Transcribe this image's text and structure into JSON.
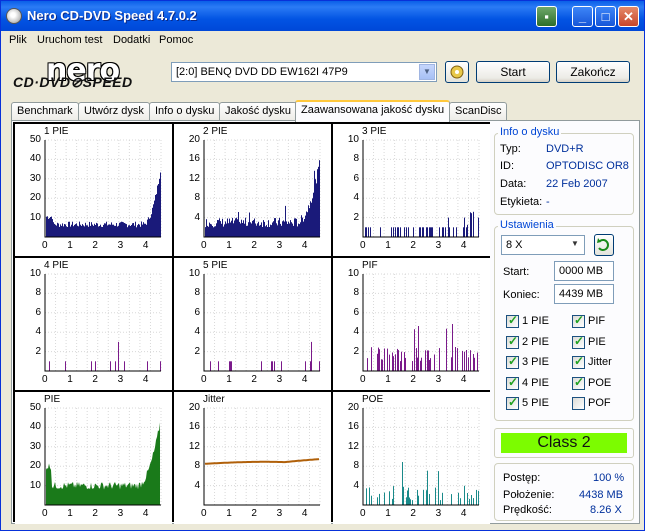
{
  "window": {
    "title": "Nero CD-DVD Speed 4.7.0.2",
    "minimize": "_",
    "maximize": "□",
    "close": "✕"
  },
  "menu": [
    "Plik",
    "Uruchom test",
    "Dodatki",
    "Pomoc"
  ],
  "logo": {
    "top": "nero",
    "bottom": "CD·DVD⊘SPEED"
  },
  "drive": {
    "selected": "[2:0]   BENQ DVD DD EW162I 47P9"
  },
  "buttons": {
    "start": "Start",
    "end": "Zakończ"
  },
  "tabs": [
    "Benchmark",
    "Utwórz dysk",
    "Info o dysku",
    "Jakość dysku",
    "Zaawansowana jakość dysku",
    "ScanDisc"
  ],
  "active_tab": 4,
  "disc_info": {
    "title": "Info o dysku",
    "type_label": "Typ:",
    "type": "DVD+R",
    "id_label": "ID:",
    "id": "OPTODISC OR8",
    "date_label": "Data:",
    "date": "22 Feb 2007",
    "label_label": "Etykieta:",
    "label": "-"
  },
  "settings": {
    "title": "Ustawienia",
    "speed": "8 X",
    "start_label": "Start:",
    "start": "0000 MB",
    "end_label": "Koniec:",
    "end": "4439 MB",
    "checks": [
      {
        "label": "1 PIE",
        "checked": true
      },
      {
        "label": "PIF",
        "checked": true
      },
      {
        "label": "2 PIE",
        "checked": true
      },
      {
        "label": "PIE",
        "checked": true
      },
      {
        "label": "3 PIE",
        "checked": true
      },
      {
        "label": "Jitter",
        "checked": true
      },
      {
        "label": "4 PIE",
        "checked": true
      },
      {
        "label": "POE",
        "checked": true
      },
      {
        "label": "5 PIE",
        "checked": true
      },
      {
        "label": "POF",
        "checked": false
      }
    ]
  },
  "class": "Class 2",
  "progress": {
    "progress_label": "Postęp:",
    "progress": "100 %",
    "position_label": "Położenie:",
    "position": "4438 MB",
    "speed_label": "Prędkość:",
    "speed": "8.26 X"
  },
  "colors": {
    "navy": "#1a1a7a",
    "purple": "#7a1a8a",
    "green": "#1a7a1a",
    "orange": "#b0600a",
    "teal": "#1a8a8a",
    "class_bg": "#7cfc00"
  },
  "chart_data": [
    {
      "type": "bar",
      "title": "1 PIE",
      "ylim": [
        0,
        50
      ],
      "yticks": [
        10,
        20,
        30,
        40,
        50
      ],
      "xticks": [
        0,
        1,
        2,
        3,
        4
      ],
      "color": "navy",
      "profile": "edge"
    },
    {
      "type": "bar",
      "title": "2 PIE",
      "ylim": [
        0,
        20
      ],
      "yticks": [
        4,
        8,
        12,
        16,
        20
      ],
      "xticks": [
        0,
        1,
        2,
        3,
        4
      ],
      "color": "navy",
      "profile": "edge2"
    },
    {
      "type": "bar",
      "title": "3 PIE",
      "ylim": [
        0,
        10
      ],
      "yticks": [
        2,
        4,
        6,
        8,
        10
      ],
      "xticks": [
        0,
        1,
        2,
        3,
        4
      ],
      "color": "navy",
      "profile": "sparse"
    },
    {
      "type": "bar",
      "title": "4 PIE",
      "ylim": [
        0,
        10
      ],
      "yticks": [
        2,
        4,
        6,
        8,
        10
      ],
      "xticks": [
        0,
        1,
        2,
        3,
        4
      ],
      "color": "purple",
      "profile": "rare"
    },
    {
      "type": "bar",
      "title": "5 PIE",
      "ylim": [
        0,
        10
      ],
      "yticks": [
        2,
        4,
        6,
        8,
        10
      ],
      "xticks": [
        0,
        1,
        2,
        3,
        4
      ],
      "color": "purple",
      "profile": "rare"
    },
    {
      "type": "bar",
      "title": "PIF",
      "ylim": [
        0,
        10
      ],
      "yticks": [
        2,
        4,
        6,
        8,
        10
      ],
      "xticks": [
        0,
        1,
        2,
        3,
        4
      ],
      "color": "purple",
      "profile": "pif"
    },
    {
      "type": "area",
      "title": "PIE",
      "ylim": [
        0,
        50
      ],
      "yticks": [
        10,
        20,
        30,
        40,
        50
      ],
      "xticks": [
        0,
        1,
        2,
        3,
        4
      ],
      "color": "green",
      "profile": "pie"
    },
    {
      "type": "line",
      "title": "Jitter",
      "ylim": [
        0,
        20
      ],
      "yticks": [
        4,
        8,
        12,
        16,
        20
      ],
      "xticks": [
        0,
        1,
        2,
        3,
        4
      ],
      "color": "orange",
      "profile": "jitter"
    },
    {
      "type": "bar",
      "title": "POE",
      "ylim": [
        0,
        20
      ],
      "yticks": [
        4,
        8,
        12,
        16,
        20
      ],
      "xticks": [
        0,
        1,
        2,
        3,
        4
      ],
      "color": "teal",
      "profile": "poe"
    }
  ]
}
